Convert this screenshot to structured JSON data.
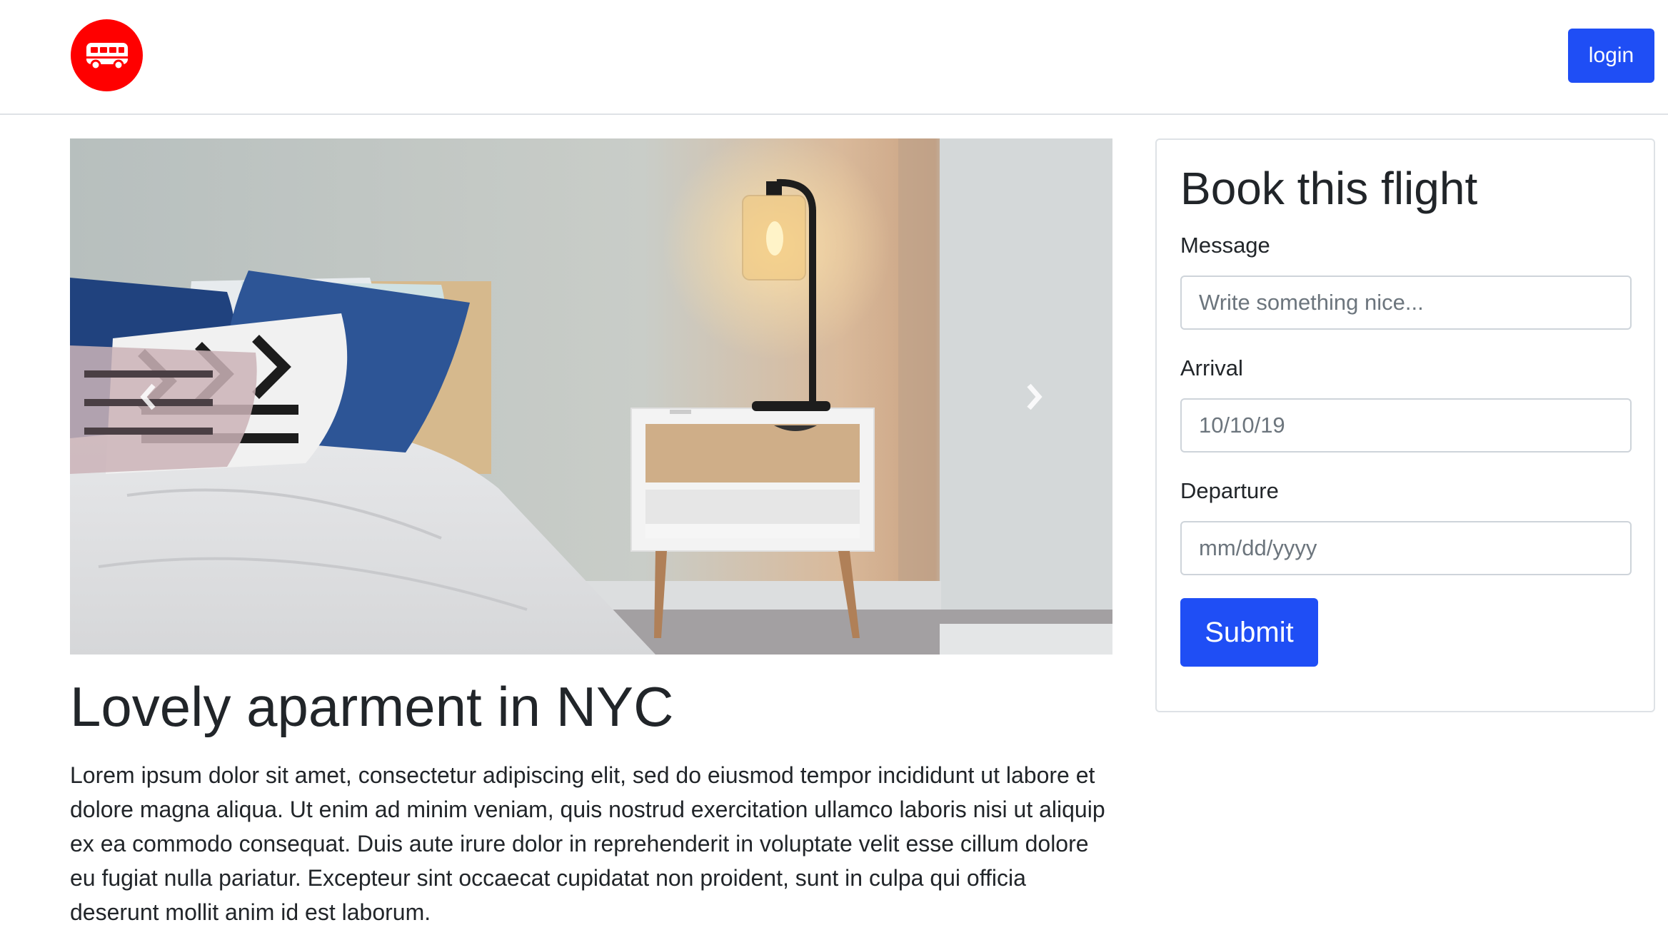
{
  "header": {
    "logo_icon": "bus-icon",
    "login_label": "login"
  },
  "carousel": {
    "prev_icon": "chevron-left-icon",
    "next_icon": "chevron-right-icon",
    "image_alt": "bedroom with bed, pillows, nightstand and lamp"
  },
  "listing": {
    "title": "Lovely aparment in NYC",
    "description": "Lorem ipsum dolor sit amet, consectetur adipiscing elit, sed do eiusmod tempor incididunt ut labore et dolore magna aliqua. Ut enim ad minim veniam, quis nostrud exercitation ullamco laboris nisi ut aliquip ex ea commodo consequat. Duis aute irure dolor in reprehenderit in voluptate velit esse cillum dolore eu fugiat nulla pariatur. Excepteur sint occaecat cupidatat non proident, sunt in culpa qui officia deserunt mollit anim id est laborum."
  },
  "booking": {
    "title": "Book this flight",
    "message_label": "Message",
    "message_placeholder": "Write something nice...",
    "arrival_label": "Arrival",
    "arrival_value": "10/10/19",
    "departure_label": "Departure",
    "departure_placeholder": "mm/dd/yyyy",
    "submit_label": "Submit"
  },
  "colors": {
    "primary": "#1f4ef5",
    "logo_bg": "#ff0000",
    "text": "#212529",
    "border": "#dee2e6"
  }
}
